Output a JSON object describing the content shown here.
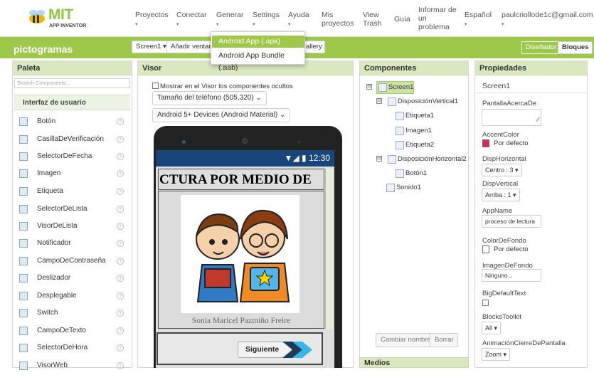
{
  "logo": {
    "brand": "MIT",
    "product": "APP INVENTOR"
  },
  "topmenu": [
    {
      "label": "Proyectos",
      "caret": "▾"
    },
    {
      "label": "Conectar",
      "caret": "▾"
    },
    {
      "label": "Generar",
      "caret": "▾"
    },
    {
      "label": "Settings",
      "caret": "▾"
    },
    {
      "label": "Ayuda",
      "caret": "▾"
    }
  ],
  "links": {
    "mis1": "Mis",
    "mis2": "proyectos",
    "view1": "View",
    "view2": "Trash",
    "guia": "Guía",
    "inf1": "Informar de",
    "inf2": "un",
    "inf3": "problema",
    "lang": "Español",
    "user": "paulcriollode1c@gmail.com",
    "caret": "▾"
  },
  "build_menu": {
    "apk": "Android App (.apk)",
    "aab": "Android App Bundle (.aab)"
  },
  "project": {
    "name": "pictogramas",
    "screen_btn": "Screen1 ▾",
    "add_window": "Añadir ventana",
    "gallery_tail": "allery",
    "designer": "Diseñador",
    "blocks": "Bloques"
  },
  "palette": {
    "title": "Paleta",
    "search_placeholder": "Search Components...",
    "section": "Interfaz de usuario",
    "help": "?",
    "items": [
      {
        "label": "Botón",
        "icon": "button-icon"
      },
      {
        "label": "CasillaDeVerificación",
        "icon": "checkbox-icon"
      },
      {
        "label": "SelectorDeFecha",
        "icon": "datepicker-icon"
      },
      {
        "label": "Imagen",
        "icon": "image-icon"
      },
      {
        "label": "Etiqueta",
        "icon": "label-icon"
      },
      {
        "label": "SelectorDeLista",
        "icon": "listpicker-icon"
      },
      {
        "label": "VisorDeLista",
        "icon": "listview-icon"
      },
      {
        "label": "Notificador",
        "icon": "notifier-icon"
      },
      {
        "label": "CampoDeContraseña",
        "icon": "password-icon"
      },
      {
        "label": "Deslizador",
        "icon": "slider-icon"
      },
      {
        "label": "Desplegable",
        "icon": "spinner-icon"
      },
      {
        "label": "Switch",
        "icon": "switch-icon"
      },
      {
        "label": "CampoDeTexto",
        "icon": "textbox-icon"
      },
      {
        "label": "SelectorDeHora",
        "icon": "timepicker-icon"
      },
      {
        "label": "VisorWeb",
        "icon": "webviewer-icon"
      }
    ]
  },
  "viewer": {
    "title": "Visor",
    "show_hidden": "Mostrar en el Visor los componentes ocultos",
    "phone_size": "Tamaño del teléfono (505,320)",
    "device": "Android 5+ Devices (Android Material)",
    "clock": "12:30",
    "heading": "CTURA POR MEDIO DE",
    "author": "Sonia Maricel Pazmiño Freire",
    "next_button": "Siguiente"
  },
  "components": {
    "title": "Componentes",
    "tree": [
      "Screen1",
      "DisposiciónVertical1",
      "Etiqueta1",
      "Imagen1",
      "Etiqueta2",
      "DisposiciónHorizontal2",
      "Botón1",
      "Sonido1"
    ],
    "rename": "Cambiar nombre",
    "delete": "Borrar",
    "media": "Medios",
    "toggle": "⊟"
  },
  "properties": {
    "title": "Propiedades",
    "component": "Screen1",
    "about": "PantallaAcercaDe",
    "accent_label": "AccentColor",
    "accent_value": "Por defecto",
    "accent_color": "#e0245e",
    "hor_label": "DispHorizontal",
    "hor_value": "Centro : 3 ▾",
    "ver_label": "DispVertical",
    "ver_value": "Arriba : 1 ▾",
    "appname_label": "AppName",
    "appname_value": "proceso de lectura",
    "bg_label": "ColorDeFondo",
    "bg_value": "Por defecto",
    "bgimg_label": "ImagenDeFondo",
    "bgimg_value": "Ninguno...",
    "bigtext_label": "BigDefaultText",
    "toolkit_label": "BlocksToolkit",
    "toolkit_value": "All ▾",
    "anim_label": "AnimaciónCierreDePantalla",
    "anim_value": "Zoom ▾"
  },
  "colors": {
    "green": "#9ec84a",
    "statusbar": "#18457a"
  }
}
